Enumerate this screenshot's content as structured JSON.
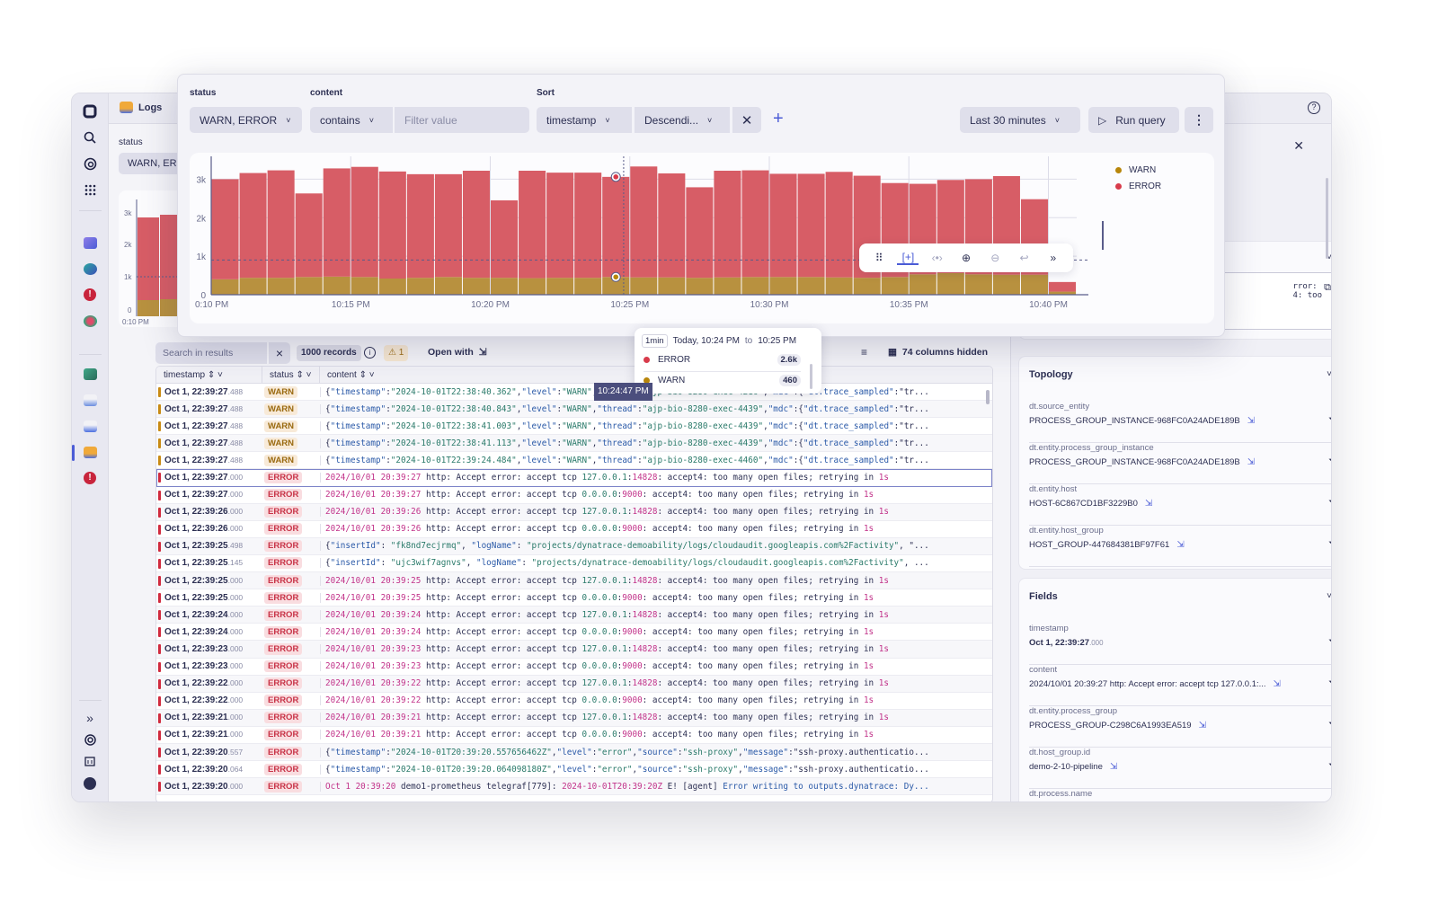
{
  "app": {
    "title": "Logs",
    "help_icon": "help-icon"
  },
  "sidebar": {
    "top_icons": [
      "dynatrace-logo-icon",
      "search-icon",
      "ai-assistant-icon",
      "apps-grid-icon"
    ],
    "app_icons": [
      "infrastructure-icon",
      "kubernetes-icon",
      "problems-icon",
      "services-icon",
      "dashboards-icon",
      "notebooks-icon",
      "workflows-icon",
      "logs-icon",
      "problems-new-icon"
    ],
    "bottom_icons": [
      "expand-icon",
      "support-icon",
      "whats-new-icon",
      "user-icon"
    ]
  },
  "background": {
    "status_label": "status",
    "status_value": "WARN, ERR",
    "y_ticks": [
      "3k",
      "2k",
      "1k",
      "0"
    ],
    "x_first": "0:10 PM"
  },
  "query": {
    "status_label": "status",
    "status_value": "WARN, ERROR",
    "content_label": "content",
    "content_operator": "contains",
    "content_placeholder": "Filter value",
    "sort_label": "Sort",
    "sort_field": "timestamp",
    "sort_order": "Descendi...",
    "timeframe": "Last 30 minutes",
    "run_label": "Run query"
  },
  "chart_toolbar": [
    "drag-handle-icon",
    "select-zoom-icon",
    "pan-icon",
    "zoom-in-icon",
    "zoom-out-icon",
    "reset-icon",
    "expand-icon"
  ],
  "tooltip": {
    "resolution": "1min",
    "range_prefix": "Today, 10:24 PM",
    "range_to": "to",
    "range_end": "10:25 PM",
    "rows": [
      {
        "name": "ERROR",
        "value": "2.6k",
        "color": "#d83b4b"
      },
      {
        "name": "WARN",
        "value": "460",
        "color": "#b8860b"
      }
    ]
  },
  "cursor_label": "10:24:47 PM",
  "chart_data": {
    "type": "bar",
    "stacked": true,
    "title": "",
    "xlabel": "",
    "ylabel": "",
    "ylim": [
      0,
      3500
    ],
    "y_ticks": [
      0,
      1000,
      2000,
      3000
    ],
    "y_tick_labels": [
      "0",
      "1k",
      "2k",
      "3k"
    ],
    "x_tick_labels": [
      "0:10 PM",
      "10:15 PM",
      "10:20 PM",
      "10:25 PM",
      "10:30 PM",
      "10:35 PM",
      "10:40 PM"
    ],
    "x_tick_positions": [
      0,
      5,
      10,
      15,
      20,
      25,
      30
    ],
    "categories": [
      "10:10",
      "10:11",
      "10:12",
      "10:13",
      "10:14",
      "10:15",
      "10:16",
      "10:17",
      "10:18",
      "10:19",
      "10:20",
      "10:21",
      "10:22",
      "10:23",
      "10:24",
      "10:25",
      "10:26",
      "10:27",
      "10:28",
      "10:29",
      "10:30",
      "10:31",
      "10:32",
      "10:33",
      "10:34",
      "10:35",
      "10:36",
      "10:37",
      "10:38",
      "10:39",
      "10:40"
    ],
    "threshold": 900,
    "legend_position": "top-right",
    "series": [
      {
        "name": "WARN",
        "color": "#b8913f",
        "values": [
          400,
          440,
          440,
          460,
          470,
          460,
          420,
          440,
          460,
          440,
          440,
          430,
          440,
          440,
          460,
          450,
          450,
          440,
          450,
          460,
          460,
          460,
          450,
          440,
          460,
          530,
          560,
          530,
          520,
          520,
          80
        ]
      },
      {
        "name": "ERROR",
        "color": "#d75d66",
        "values": [
          2600,
          2720,
          2790,
          2170,
          2810,
          2860,
          2780,
          2690,
          2670,
          2780,
          2010,
          2790,
          2730,
          2730,
          2600,
          2880,
          2700,
          2350,
          2770,
          2770,
          2680,
          2680,
          2740,
          2650,
          2440,
          2350,
          2420,
          2470,
          2560,
          1960,
          250
        ]
      }
    ]
  },
  "legend": [
    {
      "name": "WARN",
      "color": "#b8860b"
    },
    {
      "name": "ERROR",
      "color": "#d83b4b"
    }
  ],
  "results": {
    "search_placeholder": "Search in results",
    "records": "1000 records",
    "warnings": "1",
    "open_with": "Open with",
    "columns_hidden": "74 columns hidden",
    "columns": [
      "timestamp",
      "status",
      "content"
    ],
    "rows": [
      {
        "ts": "Oct 1, 22:39:27",
        "ms": ".488",
        "status": "WARN",
        "type": "json",
        "content": "{\"timestamp\":\"2024-10-01T22:38:40.362\",\"level\":\"WARN\",\"thread\":\"ajp-bio-8280-exec-4216\",\"mdc\":{\"dt.trace_sampled\":\"tr..."
      },
      {
        "ts": "Oct 1, 22:39:27",
        "ms": ".488",
        "status": "WARN",
        "type": "json",
        "content": "{\"timestamp\":\"2024-10-01T22:38:40.843\",\"level\":\"WARN\",\"thread\":\"ajp-bio-8280-exec-4439\",\"mdc\":{\"dt.trace_sampled\":\"tr..."
      },
      {
        "ts": "Oct 1, 22:39:27",
        "ms": ".488",
        "status": "WARN",
        "type": "json",
        "content": "{\"timestamp\":\"2024-10-01T22:38:41.003\",\"level\":\"WARN\",\"thread\":\"ajp-bio-8280-exec-4439\",\"mdc\":{\"dt.trace_sampled\":\"tr..."
      },
      {
        "ts": "Oct 1, 22:39:27",
        "ms": ".488",
        "status": "WARN",
        "type": "json",
        "content": "{\"timestamp\":\"2024-10-01T22:38:41.113\",\"level\":\"WARN\",\"thread\":\"ajp-bio-8280-exec-4439\",\"mdc\":{\"dt.trace_sampled\":\"tr..."
      },
      {
        "ts": "Oct 1, 22:39:27",
        "ms": ".488",
        "status": "WARN",
        "type": "json",
        "content": "{\"timestamp\":\"2024-10-01T22:39:24.484\",\"level\":\"WARN\",\"thread\":\"ajp-bio-8280-exec-4460\",\"mdc\":{\"dt.trace_sampled\":\"tr..."
      },
      {
        "ts": "Oct 1, 22:39:27",
        "ms": ".000",
        "status": "ERROR",
        "type": "text",
        "selected": true,
        "content": "2024/10/01 20:39:27 http: Accept error: accept tcp 127.0.0.1:14828: accept4: too many open files; retrying in 1s"
      },
      {
        "ts": "Oct 1, 22:39:27",
        "ms": ".000",
        "status": "ERROR",
        "type": "text",
        "content": "2024/10/01 20:39:27 http: Accept error: accept tcp 0.0.0.0:9000: accept4: too many open files; retrying in 1s"
      },
      {
        "ts": "Oct 1, 22:39:26",
        "ms": ".000",
        "status": "ERROR",
        "type": "text",
        "content": "2024/10/01 20:39:26 http: Accept error: accept tcp 127.0.0.1:14828: accept4: too many open files; retrying in 1s"
      },
      {
        "ts": "Oct 1, 22:39:26",
        "ms": ".000",
        "status": "ERROR",
        "type": "text",
        "content": "2024/10/01 20:39:26 http: Accept error: accept tcp 0.0.0.0:9000: accept4: too many open files; retrying in 1s"
      },
      {
        "ts": "Oct 1, 22:39:25",
        "ms": ".498",
        "status": "ERROR",
        "type": "json",
        "content": "{\"insertId\": \"fk8nd7ecjrmq\", \"logName\": \"projects/dynatrace-demoability/logs/cloudaudit.googleapis.com%2Factivity\", \"..."
      },
      {
        "ts": "Oct 1, 22:39:25",
        "ms": ".145",
        "status": "ERROR",
        "type": "json",
        "content": "{\"insertId\": \"ujc3wif7agnvs\", \"logName\": \"projects/dynatrace-demoability/logs/cloudaudit.googleapis.com%2Factivity\", ..."
      },
      {
        "ts": "Oct 1, 22:39:25",
        "ms": ".000",
        "status": "ERROR",
        "type": "text",
        "content": "2024/10/01 20:39:25 http: Accept error: accept tcp 127.0.0.1:14828: accept4: too many open files; retrying in 1s"
      },
      {
        "ts": "Oct 1, 22:39:25",
        "ms": ".000",
        "status": "ERROR",
        "type": "text",
        "content": "2024/10/01 20:39:25 http: Accept error: accept tcp 0.0.0.0:9000: accept4: too many open files; retrying in 1s"
      },
      {
        "ts": "Oct 1, 22:39:24",
        "ms": ".000",
        "status": "ERROR",
        "type": "text",
        "content": "2024/10/01 20:39:24 http: Accept error: accept tcp 127.0.0.1:14828: accept4: too many open files; retrying in 1s"
      },
      {
        "ts": "Oct 1, 22:39:24",
        "ms": ".000",
        "status": "ERROR",
        "type": "text",
        "content": "2024/10/01 20:39:24 http: Accept error: accept tcp 0.0.0.0:9000: accept4: too many open files; retrying in 1s"
      },
      {
        "ts": "Oct 1, 22:39:23",
        "ms": ".000",
        "status": "ERROR",
        "type": "text",
        "content": "2024/10/01 20:39:23 http: Accept error: accept tcp 127.0.0.1:14828: accept4: too many open files; retrying in 1s"
      },
      {
        "ts": "Oct 1, 22:39:23",
        "ms": ".000",
        "status": "ERROR",
        "type": "text",
        "content": "2024/10/01 20:39:23 http: Accept error: accept tcp 0.0.0.0:9000: accept4: too many open files; retrying in 1s"
      },
      {
        "ts": "Oct 1, 22:39:22",
        "ms": ".000",
        "status": "ERROR",
        "type": "text",
        "content": "2024/10/01 20:39:22 http: Accept error: accept tcp 127.0.0.1:14828: accept4: too many open files; retrying in 1s"
      },
      {
        "ts": "Oct 1, 22:39:22",
        "ms": ".000",
        "status": "ERROR",
        "type": "text",
        "content": "2024/10/01 20:39:22 http: Accept error: accept tcp 0.0.0.0:9000: accept4: too many open files; retrying in 1s"
      },
      {
        "ts": "Oct 1, 22:39:21",
        "ms": ".000",
        "status": "ERROR",
        "type": "text",
        "content": "2024/10/01 20:39:21 http: Accept error: accept tcp 127.0.0.1:14828: accept4: too many open files; retrying in 1s"
      },
      {
        "ts": "Oct 1, 22:39:21",
        "ms": ".000",
        "status": "ERROR",
        "type": "text",
        "content": "2024/10/01 20:39:21 http: Accept error: accept tcp 0.0.0.0:9000: accept4: too many open files; retrying in 1s"
      },
      {
        "ts": "Oct 1, 22:39:20",
        "ms": ".557",
        "status": "ERROR",
        "type": "json",
        "content": "{\"timestamp\":\"2024-10-01T20:39:20.557656462Z\",\"level\":\"error\",\"source\":\"ssh-proxy\",\"message\":\"ssh-proxy.authenticatio..."
      },
      {
        "ts": "Oct 1, 22:39:20",
        "ms": ".064",
        "status": "ERROR",
        "type": "json",
        "content": "{\"timestamp\":\"2024-10-01T20:39:20.064098180Z\",\"level\":\"error\",\"source\":\"ssh-proxy\",\"message\":\"ssh-proxy.authenticatio..."
      },
      {
        "ts": "Oct 1, 22:39:20",
        "ms": ".000",
        "status": "ERROR",
        "type": "text",
        "content": "Oct 1 20:39:20 demo1-prometheus telegraf[779]: 2024-10-01T20:39:20Z E! [agent] Error writing to outputs.dynatrace: Dy..."
      }
    ]
  },
  "details": {
    "snippet_line1": "rror:",
    "snippet_line2": "4: too",
    "topology": {
      "title": "Topology",
      "fields": [
        {
          "label": "dt.source_entity",
          "value": "PROCESS_GROUP_INSTANCE-968FC0A24ADE189B"
        },
        {
          "label": "dt.entity.process_group_instance",
          "value": "PROCESS_GROUP_INSTANCE-968FC0A24ADE189B"
        },
        {
          "label": "dt.entity.host",
          "value": "HOST-6C867CD1BF3229B0"
        },
        {
          "label": "dt.entity.host_group",
          "value": "HOST_GROUP-447684381BF97F61"
        }
      ]
    },
    "fields": {
      "title": "Fields",
      "items": [
        {
          "label": "timestamp",
          "value": "Oct 1, 22:39:27",
          "ms": ".000",
          "link": false
        },
        {
          "label": "content",
          "value": "2024/10/01 20:39:27 http: Accept error: accept tcp 127.0.0.1:...",
          "link": true
        },
        {
          "label": "dt.entity.process_group",
          "value": "PROCESS_GROUP-C298C6A1993EA519",
          "link": true
        },
        {
          "label": "dt.host_group.id",
          "value": "demo-2-10-pipeline",
          "link": true
        },
        {
          "label": "dt.process.name",
          "value": "",
          "link": false
        }
      ]
    }
  }
}
